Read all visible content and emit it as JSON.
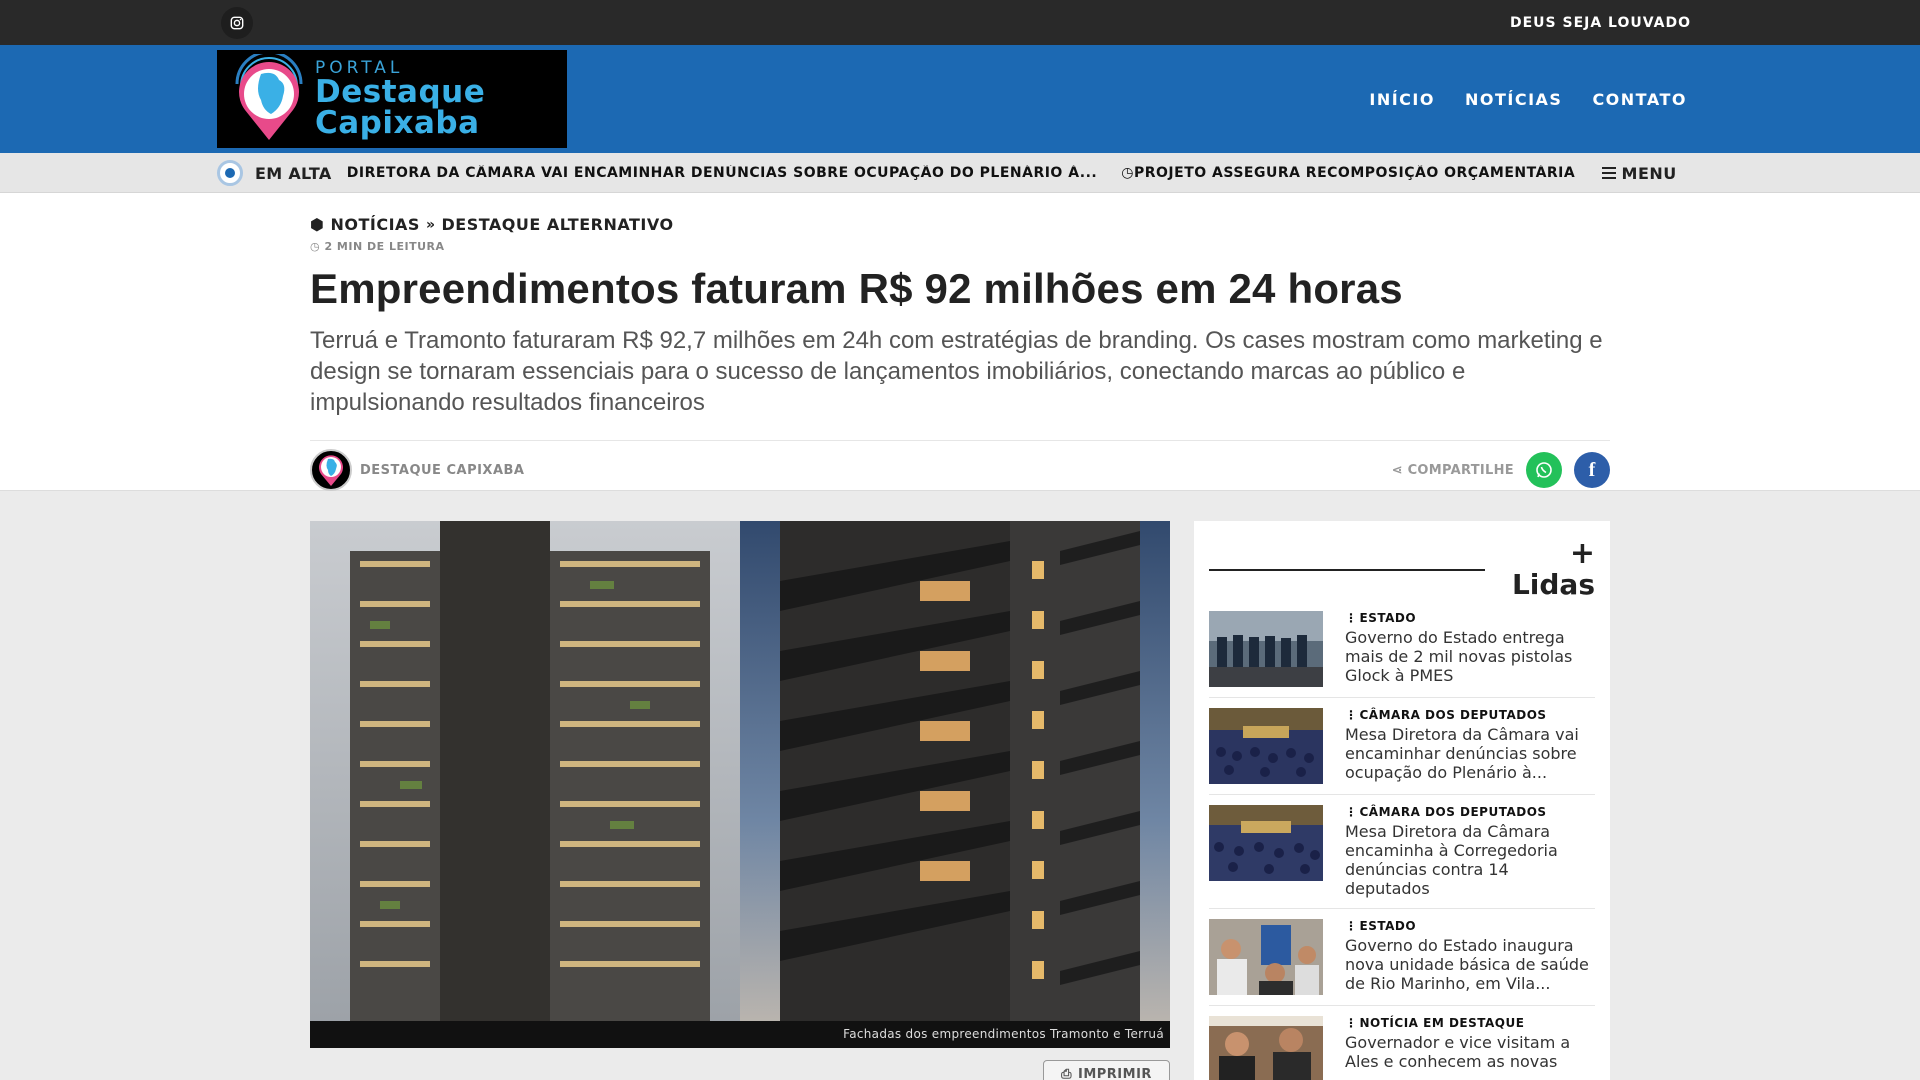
{
  "topbar": {
    "slogan": "DEUS SEJA LOUVADO",
    "icons": [
      "instagram-icon"
    ]
  },
  "logo": {
    "line1": "PORTAL",
    "line2": "Destaque",
    "line3": "Capixaba"
  },
  "nav": {
    "items": [
      {
        "label": "INÍCIO"
      },
      {
        "label": "NOTÍCIAS"
      },
      {
        "label": "CONTATO"
      }
    ]
  },
  "trending": {
    "label": "EM ALTA",
    "items": [
      "SA DIRETORA DA CÂMARA VAI ENCAMINHAR DENÚNCIAS SOBRE OCUPAÇÃO DO PLENÁRIO À...",
      "PROJETO ASSEGURA RECOMPOSIÇÃO ORÇAMENTÁRIA"
    ],
    "menu_label": "MENU"
  },
  "article": {
    "breadcrumb": [
      "NOTÍCIAS",
      "DESTAQUE ALTERNATIVO"
    ],
    "read_time": "2 MIN DE LEITURA",
    "title": "Empreendimentos faturam R$ 92 milhões em 24 horas",
    "lead": "Terruá e Tramonto faturaram R$ 92,7 milhões em 24h com estratégias de branding. Os cases mostram como marketing e design se tornaram essenciais para o sucesso de lançamentos imobiliários, conectando marcas ao público e impulsionando resultados financeiros",
    "author": "DESTAQUE CAPIXABA",
    "share_label": "COMPARTILHE",
    "image_caption": "Fachadas dos empreendimentos Tramonto e Terruá",
    "print_label": "IMPRIMIR"
  },
  "sidebar": {
    "title_plus": "+",
    "title": "Lidas",
    "items": [
      {
        "category": "ESTADO",
        "title": "Governo do Estado entrega mais de 2 mil novas pistolas Glock à PMES"
      },
      {
        "category": "CÂMARA DOS DEPUTADOS",
        "title": "Mesa Diretora da Câmara vai encaminhar denúncias sobre ocupação do Plenário à..."
      },
      {
        "category": "CÂMARA DOS DEPUTADOS",
        "title": "Mesa Diretora da Câmara encaminha à Corregedoria denúncias contra 14 deputados"
      },
      {
        "category": "ESTADO",
        "title": "Governo do Estado inaugura nova unidade básica de saúde de Rio Marinho, em Vila..."
      },
      {
        "category": "NOTÍCIA EM DESTAQUE",
        "title": "Governador e vice visitam a Ales e conhecem as novas"
      }
    ]
  },
  "colors": {
    "brand_blue": "#1c69b3",
    "topbar": "#292929",
    "whatsapp": "#23c15a",
    "facebook": "#2d5ea9"
  }
}
